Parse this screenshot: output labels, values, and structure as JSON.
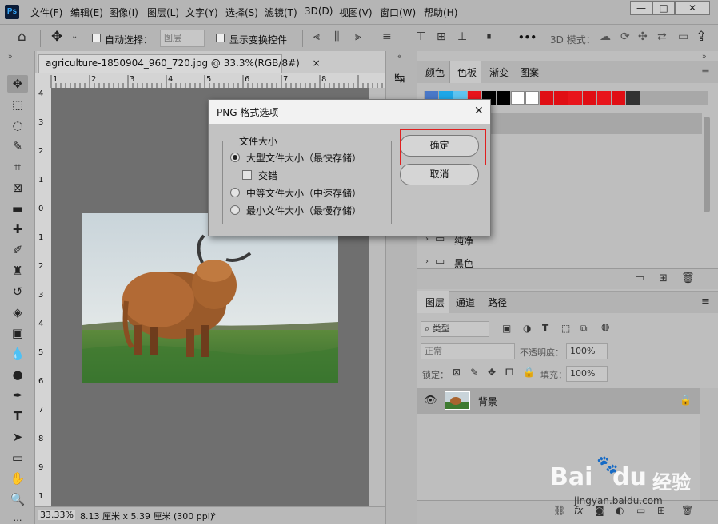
{
  "app": {
    "logo": "Ps"
  },
  "menu": [
    "文件(F)",
    "编辑(E)",
    "图像(I)",
    "图层(L)",
    "文字(Y)",
    "选择(S)",
    "滤镜(T)",
    "3D(D)",
    "视图(V)",
    "窗口(W)",
    "帮助(H)"
  ],
  "window_controls": {
    "minimize": "—",
    "maximize": "□",
    "close": "✕"
  },
  "options": {
    "auto_select": "自动选择：",
    "layer_select": "图层",
    "show_transform": "显示变换控件",
    "more": "•••",
    "mode3d": "3D 模式："
  },
  "document": {
    "tab_title": "agriculture-1850904_960_720.jpg @ 33.3%(RGB/8#)",
    "close": "×",
    "ruler_h": [
      "1",
      "2",
      "3",
      "4",
      "5",
      "6",
      "7",
      "8"
    ],
    "ruler_v": [
      "4",
      "3",
      "2",
      "1",
      "0",
      "1",
      "2",
      "3",
      "4",
      "5",
      "6",
      "7",
      "8",
      "9",
      "1"
    ]
  },
  "status": {
    "zoom": "33.33%",
    "doc_info": "8.13 厘米 x 5.39 厘米 (300 ppi)",
    "arrow": "›"
  },
  "dialog": {
    "title": "PNG 格式选项",
    "close": "✕",
    "group": "文件大小",
    "options": [
      "大型文件大小（最快存储）",
      "中等文件大小（中速存储）",
      "最小文件大小（最慢存储）"
    ],
    "selected": 0,
    "interlace": "交错",
    "ok": "确定",
    "cancel": "取消"
  },
  "panels": {
    "color_tabs": [
      "颜色",
      "色板",
      "渐变",
      "图案"
    ],
    "swatch_colors": [
      "#4a78c8",
      "#1ea7e8",
      "#5fc4f0",
      "#e8141b",
      "#000000",
      "#000000",
      "#ffffff",
      "#ffffff",
      "#e00e14",
      "#e00e14",
      "#e8141b",
      "#e00e14",
      "#e8141b",
      "#e00e14",
      "#333333"
    ],
    "swatch_groups": [
      "纯净",
      "黑色"
    ],
    "layer_tabs": [
      "图层",
      "通道",
      "路径"
    ],
    "filter_kind": "类型",
    "blend_mode": "正常",
    "opacity_label": "不透明度：",
    "opacity_value": "100%",
    "lock_label": "锁定：",
    "fill_label": "填充：",
    "fill_value": "100%",
    "layer_name": "背景",
    "collapse": "«",
    "expand": "»"
  },
  "watermark": {
    "brand": "Bai",
    "paw": "du",
    "cn": "经验",
    "url": "jingyan.baidu.com"
  },
  "colors": {
    "highlight": "#e02020",
    "dialog_bg": "#c2c2c2",
    "canvas": "#6f6f6f"
  }
}
